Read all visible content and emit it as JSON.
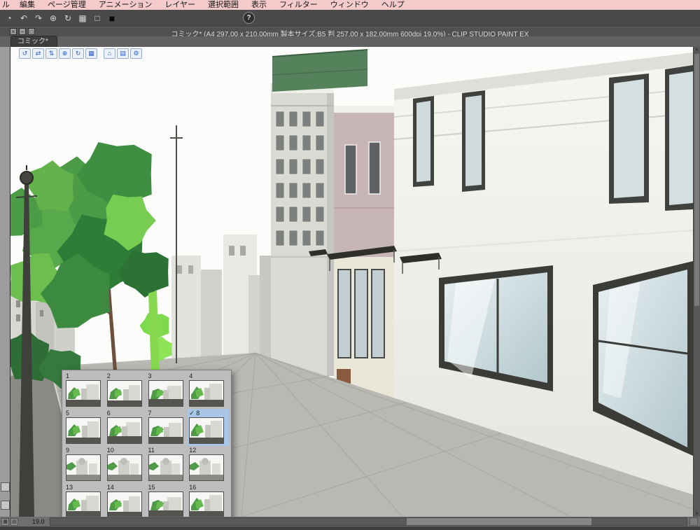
{
  "menubar": {
    "items": [
      {
        "name": "menu-file-partial",
        "label": "ル"
      },
      {
        "name": "menu-edit",
        "label": "編集"
      },
      {
        "name": "menu-page-manage",
        "label": "ページ管理"
      },
      {
        "name": "menu-animation",
        "label": "アニメーション"
      },
      {
        "name": "menu-layer",
        "label": "レイヤー"
      },
      {
        "name": "menu-selection",
        "label": "選択範囲"
      },
      {
        "name": "menu-view",
        "label": "表示"
      },
      {
        "name": "menu-filter",
        "label": "フィルター"
      },
      {
        "name": "menu-window",
        "label": "ウィンドウ"
      },
      {
        "name": "menu-help",
        "label": "ヘルプ"
      }
    ]
  },
  "command_bar": {
    "icons": [
      {
        "name": "clip-studio-icon",
        "glyph": "◔"
      },
      {
        "name": "undo-icon",
        "glyph": "↶"
      },
      {
        "name": "redo-icon",
        "glyph": "↷"
      },
      {
        "name": "snap-icon",
        "glyph": "⊕"
      },
      {
        "name": "rotate-view-icon",
        "glyph": "↻"
      },
      {
        "name": "grid-icon",
        "glyph": "▦"
      },
      {
        "name": "page-icon",
        "glyph": "□"
      },
      {
        "name": "foreground-color-swatch",
        "glyph": "■"
      }
    ],
    "help": {
      "name": "help-icon",
      "glyph": "?"
    }
  },
  "document_window": {
    "controls": [
      {
        "name": "close-button",
        "glyph": "×"
      },
      {
        "name": "minimize-button",
        "glyph": "–"
      },
      {
        "name": "maximize-button",
        "glyph": "□"
      }
    ],
    "title": "コミック* (A4 297.00 x 210.00mm 製本サイズ:B5 判 257.00 x 182.00mm 600dpi 19.0%)  - CLIP STUDIO PAINT EX"
  },
  "canvas_tab": {
    "label": "コミック*"
  },
  "threed_toolbar": {
    "icons": [
      {
        "name": "3d-camera-rotate-icon",
        "glyph": "↺"
      },
      {
        "name": "3d-camera-pan-icon",
        "glyph": "⇄"
      },
      {
        "name": "3d-camera-dolly-icon",
        "glyph": "⇅"
      },
      {
        "name": "3d-object-move-icon",
        "glyph": "⊕"
      },
      {
        "name": "3d-object-rotate-icon",
        "glyph": "↻"
      },
      {
        "name": "3d-object-snap-icon",
        "glyph": "▦"
      },
      {
        "name": "3d-root-position-icon",
        "glyph": "⌂"
      },
      {
        "name": "3d-object-list-icon",
        "glyph": "▤"
      },
      {
        "name": "3d-settings-icon",
        "glyph": "⚙"
      }
    ]
  },
  "thumbnail_panel": {
    "check_glyph": "✓",
    "items": [
      {
        "number": "1",
        "selected": false
      },
      {
        "number": "2",
        "selected": false
      },
      {
        "number": "3",
        "selected": false
      },
      {
        "number": "4",
        "selected": false
      },
      {
        "number": "5",
        "selected": false
      },
      {
        "number": "6",
        "selected": false
      },
      {
        "number": "7",
        "selected": false
      },
      {
        "number": "8",
        "selected": true
      },
      {
        "number": "9",
        "selected": false
      },
      {
        "number": "10",
        "selected": false
      },
      {
        "number": "11",
        "selected": false
      },
      {
        "number": "12",
        "selected": false
      },
      {
        "number": "13",
        "selected": false
      },
      {
        "number": "14",
        "selected": false
      },
      {
        "number": "15",
        "selected": false
      },
      {
        "number": "16",
        "selected": false
      }
    ]
  },
  "status_bar": {
    "zoom": "19.0",
    "buttons": [
      {
        "name": "canvas-nav-button",
        "glyph": "▦"
      },
      {
        "name": "page-nav-button",
        "glyph": "▤"
      }
    ]
  },
  "scrollbars": {
    "up": "▲",
    "down": "▼"
  },
  "colors": {
    "menubar_bg": "#f5caca",
    "commandbar_bg": "#4a4a4a",
    "selection_blue": "#a9c6e6",
    "threed_icon_blue": "#2b5dc4",
    "tree_green": "#4c9b47",
    "roof_green": "#54825b"
  }
}
